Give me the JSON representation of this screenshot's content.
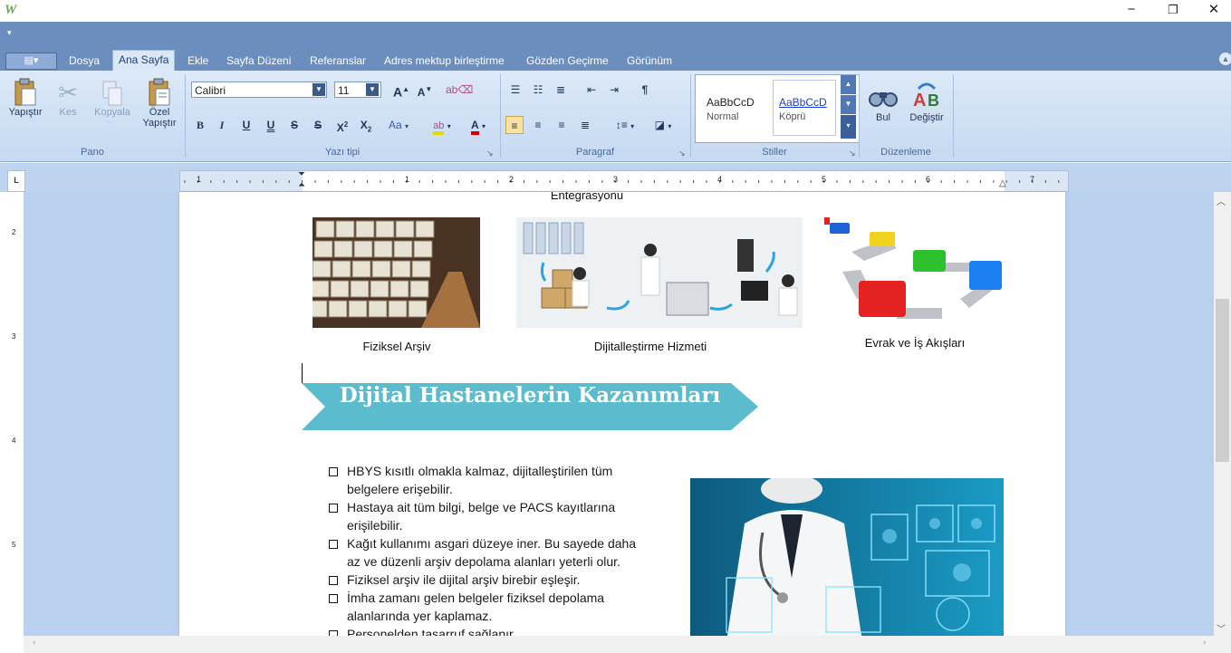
{
  "window": {
    "logo_letter": "W",
    "controls": {
      "minimize": "−",
      "restore": "❐",
      "close": "✕"
    }
  },
  "tabs": [
    "Dosya",
    "Ana Sayfa",
    "Ekle",
    "Sayfa Düzeni",
    "Referanslar",
    "Adres mektup birleştirme",
    "Gözden Geçirme",
    "Görünüm"
  ],
  "active_tab": "Ana Sayfa",
  "ribbon": {
    "clipboard": {
      "label": "Pano",
      "paste": "Yapıştır",
      "cut": "Kes",
      "copy": "Kopyala",
      "paste_special_1": "Özel",
      "paste_special_2": "Yapıştır"
    },
    "font": {
      "label": "Yazı tipi",
      "family": "Calibri",
      "size": "11",
      "grow": "A",
      "shrink": "A",
      "bold": "B",
      "italic": "I",
      "underline": "U",
      "double_underline": "U",
      "strike": "S",
      "double_strike": "S",
      "superscript": "X",
      "subscript": "X",
      "case": "Aa",
      "font_color": "A"
    },
    "paragraph": {
      "label": "Paragraf",
      "pilcrow": "¶"
    },
    "styles": {
      "label": "Stiller",
      "normal_sample": "AaBbCcD",
      "normal_name": "Normal",
      "link_sample": "AaBbCcD",
      "link_name": "Köprü"
    },
    "editing": {
      "label": "Düzenleme",
      "find": "Bul",
      "replace": "Değiştir"
    }
  },
  "ruler": {
    "corner": "L",
    "h_numbers": [
      "1",
      "1",
      "2",
      "3",
      "4",
      "5",
      "6",
      "7"
    ],
    "v_numbers": [
      "2",
      "3",
      "4",
      "5"
    ]
  },
  "document": {
    "top_caption": "Entegrasyonu",
    "captions": [
      "Fiziksel Arşiv",
      "Dijitalleştirme Hizmeti",
      "Evrak ve İş Akışları"
    ],
    "banner": "Dijital Hastanelerin Kazanımları",
    "bullets": [
      [
        "HBYS kısıtlı olmakla kalmaz, dijitalleştirilen tüm",
        "belgelere erişebilir."
      ],
      [
        "Hastaya ait tüm bilgi, belge ve PACS kayıtlarına",
        "erişilebilir."
      ],
      [
        "Kağıt kullanımı asgari düzeye iner. Bu sayede daha",
        "az ve düzenli arşiv depolama alanları yeterli olur."
      ],
      [
        "Fiziksel arşiv ile dijital arşiv birebir eşleşir."
      ],
      [
        "İmha zamanı gelen belgeler fiziksel depolama",
        "alanlarında yer kaplamaz."
      ],
      [
        "Personelden tasarruf sağlanır."
      ]
    ]
  },
  "colors": {
    "ribbon_blue": "#6c8ebf",
    "banner": "#5bbccd",
    "workspace": "#b9d0ee"
  }
}
